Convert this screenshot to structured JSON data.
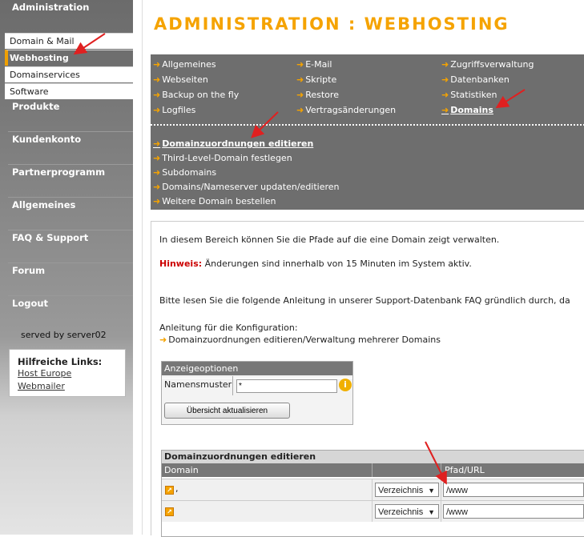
{
  "sidebar": {
    "heads": [
      "Administration",
      "Produkte",
      "Kundenkonto",
      "Partnerprogramm",
      "Allgemeines",
      "FAQ & Support",
      "Forum",
      "Logout"
    ],
    "admin_items": [
      "Domain & Mail",
      "Webhosting",
      "Domainservices",
      "Software"
    ],
    "served": "served by server02",
    "help_title": "Hilfreiche Links:",
    "help_links": [
      "Host Europe",
      "Webmailer"
    ]
  },
  "page": {
    "title": "ADMINISTRATION : WEBHOSTING"
  },
  "nav": {
    "col1": [
      "Allgemeines",
      "Webseiten",
      "Backup on the fly",
      "Logfiles"
    ],
    "col2": [
      "E-Mail",
      "Skripte",
      "Restore",
      "Vertragsänderungen"
    ],
    "col3": [
      "Zugriffsverwaltung",
      "Datenbanken",
      "Statistiken",
      "Domains"
    ],
    "sub": [
      "Domainzuordnungen editieren",
      "Third-Level-Domain festlegen",
      "Subdomains",
      "Domains/Nameserver updaten/editieren",
      "Weitere Domain bestellen"
    ]
  },
  "content": {
    "intro": "In diesem Bereich können Sie die Pfade auf die eine Domain zeigt verwalten.",
    "hinweis_label": "Hinweis:",
    "hinweis_text": " Änderungen sind innerhalb von 15 Minuten im System aktiv.",
    "guide": "Bitte lesen Sie die folgende Anleitung in unserer Support-Datenbank FAQ gründlich durch, da",
    "anleitung": "Anleitung für die Konfiguration:",
    "anleitung_link": "Domainzuordnungen editieren/Verwaltung mehrerer Domains"
  },
  "options": {
    "header": "Anzeigeoptionen",
    "label": "Namensmuster",
    "value": "*",
    "button": "Übersicht aktualisieren"
  },
  "table": {
    "title": "Domainzuordnungen editieren",
    "col_domain": "Domain",
    "col_path": "Pfad/URL",
    "rows": [
      {
        "suffix": ",",
        "type": "Verzeichnis",
        "path": "/www"
      },
      {
        "suffix": "",
        "type": "Verzeichnis",
        "path": "/www"
      }
    ]
  },
  "colors": {
    "accent": "#f5a300",
    "nav_bg": "#6e6e6e",
    "hinweis": "#cc0000",
    "arrow": "#e02020"
  },
  "icons": [
    "arrow-right-icon",
    "info-icon",
    "domain-link-icon",
    "chevron-down-icon"
  ]
}
